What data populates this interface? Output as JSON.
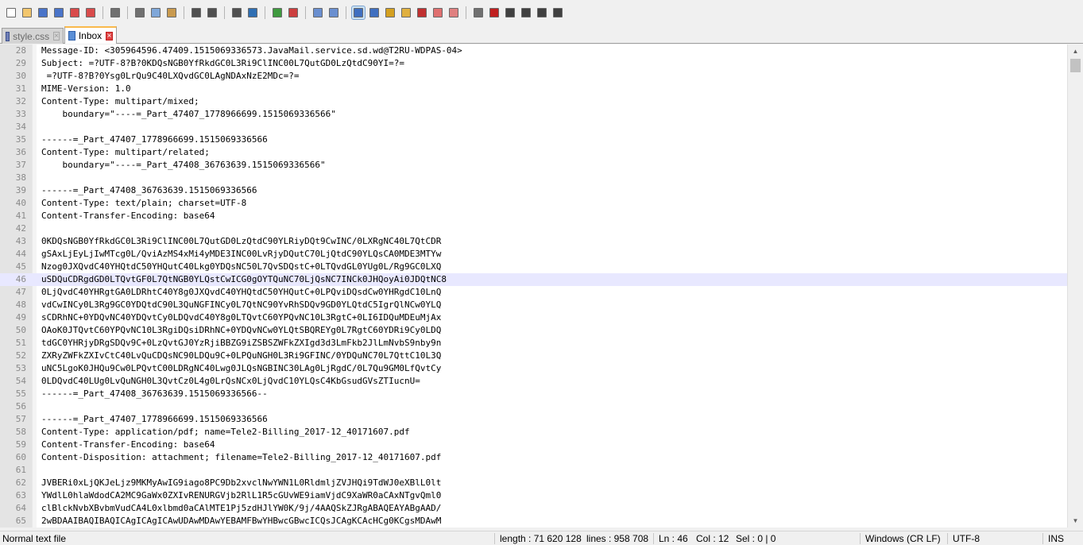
{
  "toolbar": {
    "buttons": [
      "new-file-icon",
      "open-file-icon",
      "save-icon",
      "save-all-icon",
      "close-icon",
      "close-all-icon",
      "print-icon",
      "cut-icon",
      "copy-icon",
      "paste-icon",
      "undo-icon",
      "redo-icon",
      "find-icon",
      "replace-icon",
      "zoom-in-icon",
      "zoom-out-icon",
      "sync-vertical-icon",
      "sync-horizontal-icon",
      "word-wrap-icon",
      "show-all-chars-icon",
      "indent-guide-icon",
      "user-language-icon",
      "doc-map-icon",
      "function-list-icon",
      "folder-workspace-icon",
      "monitoring-icon",
      "record-macro-icon",
      "stop-macro-icon",
      "play-macro-icon",
      "run-macro-icon",
      "save-macro-icon"
    ]
  },
  "tabs": [
    {
      "label": "style.css",
      "active": false
    },
    {
      "label": "Inbox",
      "active": true
    }
  ],
  "editor": {
    "current_line": 46,
    "lines": [
      {
        "n": "28",
        "t": "Message-ID: <305964596.47409.1515069336573.JavaMail.service.sd.wd@T2RU-WDPAS-04>"
      },
      {
        "n": "29",
        "t": "Subject: =?UTF-8?B?0KDQsNGB0YfRkdGC0L3Ri9ClINC00L7QutGD0LzQtdC90YI=?="
      },
      {
        "n": "30",
        "t": " =?UTF-8?B?0Ysg0LrQu9C40LXQvdGC0LAgNDAxNzE2MDc=?="
      },
      {
        "n": "31",
        "t": "MIME-Version: 1.0"
      },
      {
        "n": "32",
        "t": "Content-Type: multipart/mixed;"
      },
      {
        "n": "33",
        "t": "    boundary=\"----=_Part_47407_1778966699.1515069336566\""
      },
      {
        "n": "34",
        "t": ""
      },
      {
        "n": "35",
        "t": "------=_Part_47407_1778966699.1515069336566"
      },
      {
        "n": "36",
        "t": "Content-Type: multipart/related;"
      },
      {
        "n": "37",
        "t": "    boundary=\"----=_Part_47408_36763639.1515069336566\""
      },
      {
        "n": "38",
        "t": ""
      },
      {
        "n": "39",
        "t": "------=_Part_47408_36763639.1515069336566"
      },
      {
        "n": "40",
        "t": "Content-Type: text/plain; charset=UTF-8"
      },
      {
        "n": "41",
        "t": "Content-Transfer-Encoding: base64"
      },
      {
        "n": "42",
        "t": ""
      },
      {
        "n": "43",
        "t": "0KDQsNGB0YfRkdGC0L3Ri9ClINC00L7QutGD0LzQtdC90YLRiyDQt9CwINC/0LXRgNC40L7QtCDR"
      },
      {
        "n": "44",
        "t": "gSAxLjEyLjIwMTcg0L/QviAzMS4xMi4yMDE3INC00LvRjyDQutC70LjQtdC90YLQsCA0MDE3MTYw"
      },
      {
        "n": "45",
        "t": "Nzog0JXQvdC40YHQtdC50YHQutC40Lkg0YDQsNC50L7QvSDQstC+0LTQvdGL0YUg0L/Rg9GC0LXQ"
      },
      {
        "n": "46",
        "t": "uSDQuCDRgdGD0LTQvtGF0L7QtNGB0YLQstCwICG0gOYTQuNC70LjQsNC7INCk0JHQoyAi0JDQtNC8"
      },
      {
        "n": "47",
        "t": "0LjQvdC40YHRgtGA0LDRhtC40Y8g0JXQvdC40YHQtdC50YHQutC+0LPQviDQsdCw0YHRgdC10LnQ"
      },
      {
        "n": "48",
        "t": "vdCwINCy0L3Rg9GC0YDQtdC90L3QuNGFINCy0L7QtNC90YvRhSDQv9GD0YLQtdC5IgrQlNCw0YLQ"
      },
      {
        "n": "49",
        "t": "sCDRhNC+0YDQvNC40YDQvtCy0LDQvdC40Y8g0LTQvtC60YPQvNC10L3RgtC+0LI6IDQuMDEuMjAx"
      },
      {
        "n": "50",
        "t": "OAoK0JTQvtC60YPQvNC10L3RgiDQsiDRhNC+0YDQvNCw0YLQtSBQREYg0L7RgtC60YDRi9Cy0LDQ"
      },
      {
        "n": "51",
        "t": "tdGC0YHRjyDRgSDQv9C+0LzQvtGJ0YzRjiBBZG9iZSBSZWFkZXIgd3d3LmFkb2JlLmNvbS9nby9n"
      },
      {
        "n": "52",
        "t": "ZXRyZWFkZXIvCtC40LvQuCDQsNC90LDQu9C+0LPQuNGH0L3Ri9GFINC/0YDQuNC70L7QttC10L3Q"
      },
      {
        "n": "53",
        "t": "uNC5LgoK0JHQu9Cw0LPQvtC00LDRgNC40Lwg0JLQsNGBINC30LAg0LjRgdC/0L7Qu9GM0LfQvtCy"
      },
      {
        "n": "54",
        "t": "0LDQvdC40LUg0LvQuNGH0L3QvtCz0L4g0LrQsNCx0LjQvdC10YLQsC4KbGsudGVsZTIucnU="
      },
      {
        "n": "55",
        "t": "------=_Part_47408_36763639.1515069336566--"
      },
      {
        "n": "56",
        "t": ""
      },
      {
        "n": "57",
        "t": "------=_Part_47407_1778966699.1515069336566"
      },
      {
        "n": "58",
        "t": "Content-Type: application/pdf; name=Tele2-Billing_2017-12_40171607.pdf"
      },
      {
        "n": "59",
        "t": "Content-Transfer-Encoding: base64"
      },
      {
        "n": "60",
        "t": "Content-Disposition: attachment; filename=Tele2-Billing_2017-12_40171607.pdf"
      },
      {
        "n": "61",
        "t": ""
      },
      {
        "n": "62",
        "t": "JVBERi0xLjQKJeLjz9MKMyAwIG9iago8PC9Db2xvclNwYWN1L0RldmljZVJHQi9TdWJ0eXBlL0lt"
      },
      {
        "n": "63",
        "t": "YWdlL0hlaWdodCA2MC9GaWx0ZXIvRENURGVjb2RlL1R5cGUvWE9iamVjdC9XaWR0aCAxNTgvQml0"
      },
      {
        "n": "64",
        "t": "clBlckNvbXBvbmVudCA4L0xlbmd0aCAlMTE1Pj5zdHJlYW0K/9j/4AAQSkZJRgABAQEAYABgAAD/"
      },
      {
        "n": "65",
        "t": "2wBDAAIBAQIBAQICAgICAgICAwUDAwMDAwYEBAMFBwYHBwcGBwcICQsJCAgKCAcHCg0KCgsMDAwM"
      }
    ]
  },
  "status": {
    "file_type": "Normal text file",
    "length": "length : 71 620 128",
    "lines": "lines : 958 708",
    "ln": "Ln : 46",
    "col": "Col : 12",
    "sel": "Sel : 0 | 0",
    "eol": "Windows (CR LF)",
    "encoding": "UTF-8",
    "mode": "INS"
  }
}
